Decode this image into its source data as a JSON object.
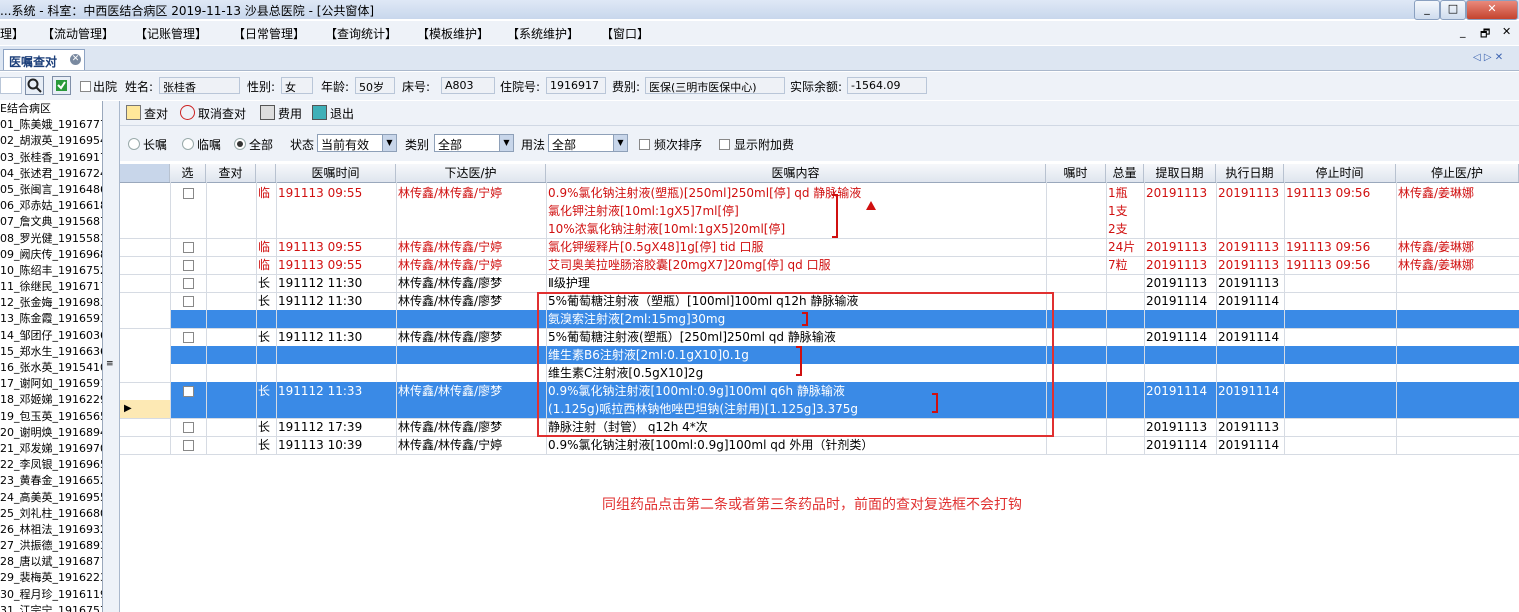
{
  "window": {
    "title": "...系统 - 科室：中西医结合病区  2019-11-13  沙县总医院 - [公共窗体]",
    "btn_min": "_",
    "btn_max": "□",
    "btn_close": "✕"
  },
  "menu": [
    "理】",
    "【流动管理】",
    "【记账管理】",
    "【日常管理】",
    "【查询统计】",
    "【模板维护】",
    "【系统维护】",
    "【窗口】"
  ],
  "mdi": {
    "min": "_",
    "restore": "🗗",
    "close": "✕"
  },
  "tab": {
    "label": "医嘱查对",
    "close": "✕"
  },
  "nav_arrows": "◁ ▷ ✕",
  "patient": {
    "search_value": "",
    "discharge_label": "出院",
    "name_label": "姓名:",
    "name": "张桂香",
    "sex_label": "性别:",
    "sex": "女",
    "age_label": "年龄:",
    "age": "50岁",
    "bed_label": "床号:",
    "bed": "A803",
    "inpatient_label": "住院号:",
    "inpatient_no": "1916917",
    "fee_label": "费别:",
    "fee_type": "医保(三明市医保中心)",
    "balance_label": "实际余额:",
    "balance": "-1564.09"
  },
  "sidebar": {
    "header": "E结合病区",
    "items": [
      "01_陈美娥_1916777",
      "02_胡淑英_1916954",
      "03_张桂香_1916917",
      "04_张述君_1916724",
      "05_张闽言_1916486",
      "06_邓赤姑_1916618",
      "07_詹文典_1915687",
      "08_罗光健_1915583",
      "09_阙庆传_1916968",
      "10_陈绍丰_1916752",
      "11_徐继民_1916717",
      "12_张金娒_1916983",
      "13_陈金霞_1916593",
      "14_邹团仔_1916036",
      "15_郑水生_1916636",
      "16_张水英_1915410",
      "17_谢阿如_1916591",
      "18_邓姬娣_1916229",
      "19_包玉英_1916565",
      "20_谢明焕_1916894",
      "21_邓发娣_1916970",
      "22_李凤银_1916965",
      "23_黄春金_1916652",
      "24_高美英_1916955",
      "25_刘礼柱_1916680",
      "26_林祖法_1916932",
      "27_洪振德_1916893",
      "28_唐以斌_1916877",
      "29_裴梅英_1916223",
      "30_程月珍_1916119",
      "31_江宗宁_1916757"
    ]
  },
  "toolbar": {
    "check": "查对",
    "uncheck": "取消查对",
    "cost": "费用",
    "exit": "退出"
  },
  "filters": {
    "long": "长嘱",
    "temp": "临嘱",
    "all": "全部",
    "status_label": "状态",
    "status_value": "当前有效",
    "category_label": "类别",
    "category_value": "全部",
    "usage_label": "用法",
    "usage_value": "全部",
    "freq_sort": "频次排序",
    "show_extra": "显示附加费"
  },
  "columns": [
    "选",
    "查对",
    "",
    "医嘱时间",
    "下达医/护",
    "医嘱内容",
    "嘱时",
    "总量",
    "提取日期",
    "执行日期",
    "停止时间",
    "停止医/护"
  ],
  "rows": [
    {
      "type": "临",
      "time": "191113 09:55",
      "doctor": "林传鑫/林传鑫/宁婷",
      "content": [
        "0.9%氯化钠注射液(塑瓶)[250ml]250ml[停] qd 静脉输液",
        "氯化钾注射液[10ml:1gX5]7ml[停]",
        "10%浓氯化钠注射液[10ml:1gX5]20ml[停]"
      ],
      "total": [
        "1瓶",
        "1支",
        "2支"
      ],
      "extract": "20191113",
      "exec": "20191113",
      "stop": "191113 09:56",
      "stopdoc": "林传鑫/姜琳娜"
    },
    {
      "type": "临",
      "time": "191113 09:55",
      "doctor": "林传鑫/林传鑫/宁婷",
      "content": [
        "氯化钾缓释片[0.5gX48]1g[停] tid 口服"
      ],
      "total": [
        "24片"
      ],
      "extract": "20191113",
      "exec": "20191113",
      "stop": "191113 09:56",
      "stopdoc": "林传鑫/姜琳娜"
    },
    {
      "type": "临",
      "time": "191113 09:55",
      "doctor": "林传鑫/林传鑫/宁婷",
      "content": [
        "艾司奥美拉唑肠溶胶囊[20mgX7]20mg[停] qd 口服"
      ],
      "total": [
        "7粒"
      ],
      "extract": "20191113",
      "exec": "20191113",
      "stop": "191113 09:56",
      "stopdoc": "林传鑫/姜琳娜"
    },
    {
      "type": "长",
      "time": "191112 11:30",
      "doctor": "林传鑫/林传鑫/廖梦",
      "content": [
        "Ⅱ级护理"
      ],
      "total": [
        ""
      ],
      "extract": "20191113",
      "exec": "20191113",
      "stop": "",
      "stopdoc": ""
    },
    {
      "type": "长",
      "time": "191112 11:30",
      "doctor": "林传鑫/林传鑫/廖梦",
      "content": [
        "5%葡萄糖注射液（塑瓶）[100ml]100ml q12h 静脉输液",
        "氨溴索注射液[2ml:15mg]30mg"
      ],
      "total": [
        ""
      ],
      "extract": "20191114",
      "exec": "20191114",
      "stop": "",
      "stopdoc": ""
    },
    {
      "type": "长",
      "time": "191112 11:30",
      "doctor": "林传鑫/林传鑫/廖梦",
      "content": [
        "5%葡萄糖注射液(塑瓶）[250ml]250ml qd 静脉输液",
        "维生素B6注射液[2ml:0.1gX10]0.1g",
        "维生素C注射液[0.5gX10]2g"
      ],
      "total": [
        ""
      ],
      "extract": "20191114",
      "exec": "20191114",
      "stop": "",
      "stopdoc": ""
    },
    {
      "type": "长",
      "time": "191112 11:33",
      "doctor": "林传鑫/林传鑫/廖梦",
      "content": [
        "0.9%氯化钠注射液[100ml:0.9g]100ml                  q6h 静脉输液",
        "(1.125g)哌拉西林钠他唑巴坦钠(注射用)[1.125g]3.375g"
      ],
      "total": [
        ""
      ],
      "extract": "20191114",
      "exec": "20191114",
      "stop": "",
      "stopdoc": ""
    },
    {
      "type": "长",
      "time": "191112 17:39",
      "doctor": "林传鑫/林传鑫/廖梦",
      "content": [
        "静脉注射（封管） q12h 4*次"
      ],
      "total": [
        ""
      ],
      "extract": "20191113",
      "exec": "20191113",
      "stop": "",
      "stopdoc": ""
    },
    {
      "type": "长",
      "time": "191113 10:39",
      "doctor": "林传鑫/林传鑫/宁婷",
      "content": [
        "0.9%氯化钠注射液[100ml:0.9g]100ml qd 外用（针剂类）"
      ],
      "total": [
        ""
      ],
      "extract": "20191114",
      "exec": "20191114",
      "stop": "",
      "stopdoc": ""
    }
  ],
  "annotation": "同组药品点击第二条或者第三条药品时，前面的查对复选框不会打钩",
  "colors": {
    "red": "#d01010",
    "selected": "#3a8ae6",
    "annotation": "#e03030"
  }
}
